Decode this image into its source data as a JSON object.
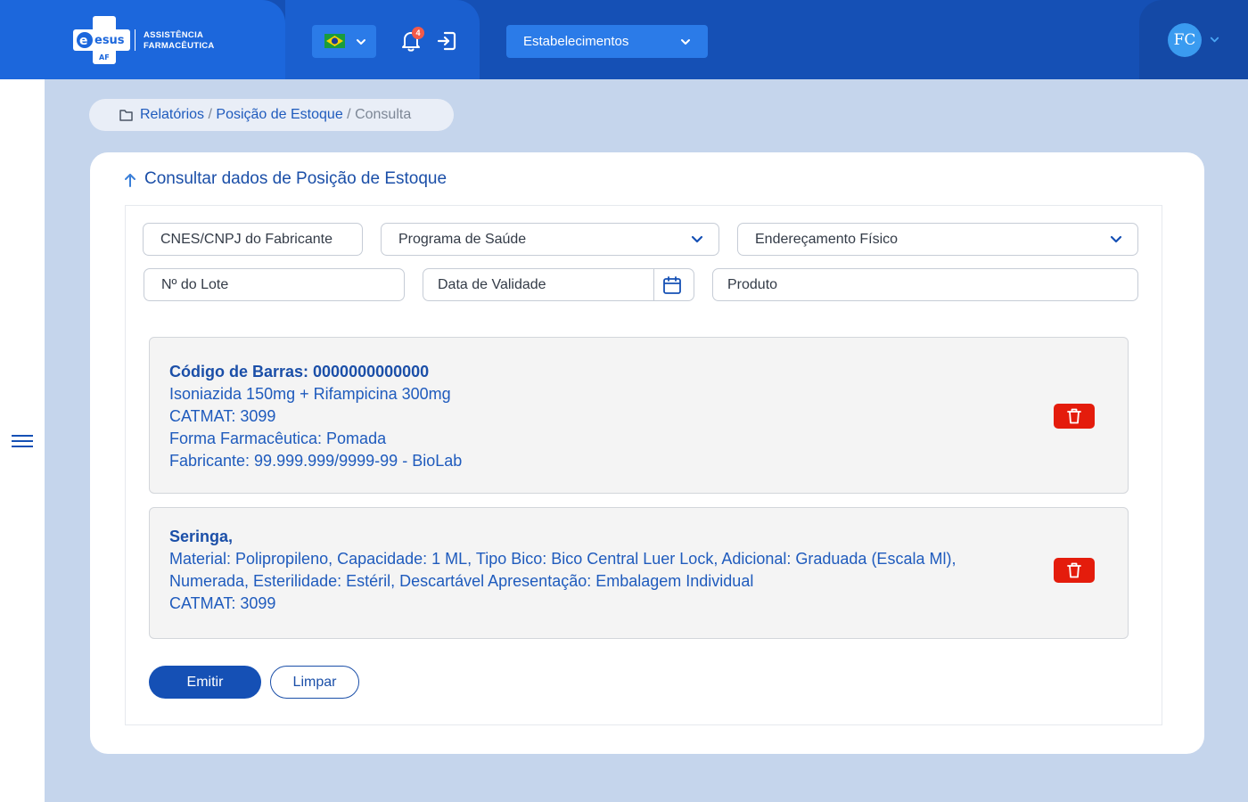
{
  "header": {
    "logo": {
      "brand": "esus",
      "sub": "AF",
      "line1": "ASSISTÊNCIA",
      "line2": "FARMACÊUTICA"
    },
    "language": {
      "flag_icon": "brazil-flag-icon"
    },
    "notifications": {
      "count": "4"
    },
    "establishment": {
      "label": "Estabelecimentos"
    },
    "user": {
      "initials": "FC"
    }
  },
  "breadcrumb": {
    "items": [
      "Relatórios",
      "Posição de Estoque",
      "Consulta"
    ],
    "separator": "/"
  },
  "form": {
    "title": "Consultar dados de Posição de Estoque",
    "fields": {
      "cnes": "CNES/CNPJ do Fabricante",
      "programa": "Programa de Saúde",
      "endereco": "Endereçamento Físico",
      "lote": "Nº do Lote",
      "validade": "Data de Validade",
      "produto": "Produto"
    }
  },
  "items": [
    {
      "lines": [
        "Código de Barras: 0000000000000",
        "Isoniazida 150mg + Rifampicina 300mg",
        "CATMAT: 3099",
        "Forma Farmacêutica: Pomada",
        "Fabricante: 99.999.999/9999-99 - BioLab"
      ]
    },
    {
      "lines": [
        "Seringa,",
        "Material: Polipropileno, Capacidade: 1 ML, Tipo Bico: Bico Central Luer Lock, Adicional: Graduada (Escala Ml),",
        "Numerada, Esterilidade: Estéril, Descartável Apresentação: Embalagem Individual",
        "CATMAT: 3099"
      ]
    }
  ],
  "actions": {
    "emit": "Emitir",
    "clear": "Limpar"
  },
  "colors": {
    "primary": "#1550b5",
    "danger": "#e41c0c",
    "background": "#c5d5ec"
  }
}
